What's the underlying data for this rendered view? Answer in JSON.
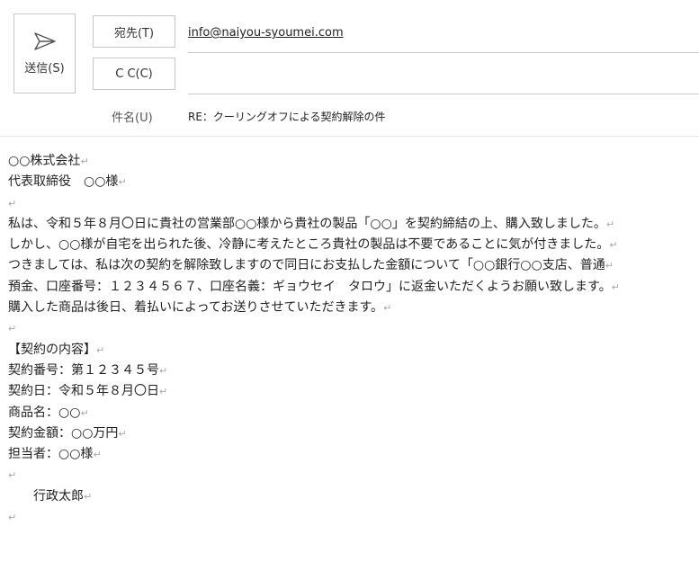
{
  "compose": {
    "send_label": "送信(S)",
    "to_label": "宛先(T)",
    "cc_label": "C C(C)",
    "to_value": "info@naiyou-syoumei.com",
    "cc_value": "",
    "subject_label": "件名(U)",
    "subject_value": "RE：クーリングオフによる契約解除の件"
  },
  "body": {
    "paragraph_mark": "↵",
    "lines": [
      "○○株式会社",
      "代表取締役　○○様",
      "",
      "私は、令和５年８月〇日に貴社の営業部○○様から貴社の製品「○○」を契約締結の上、購入致しました。",
      "しかし、○○様が自宅を出られた後、冷静に考えたところ貴社の製品は不要であることに気が付きました。",
      "つきましては、私は次の契約を解除致しますので同日にお支払した金額について「○○銀行○○支店、普通",
      "預金、口座番号：１２３４５６７、口座名義：ギョウセイ　タロウ」に返金いただくようお願い致します。",
      "購入した商品は後日、着払いによってお送りさせていただきます。",
      "",
      "【契約の内容】",
      "契約番号：第１２３４５号",
      "契約日：令和５年８月〇日",
      "商品名：○○",
      "契約金額：○○万円",
      "担当者：○○様",
      "",
      "　　行政太郎",
      ""
    ]
  }
}
